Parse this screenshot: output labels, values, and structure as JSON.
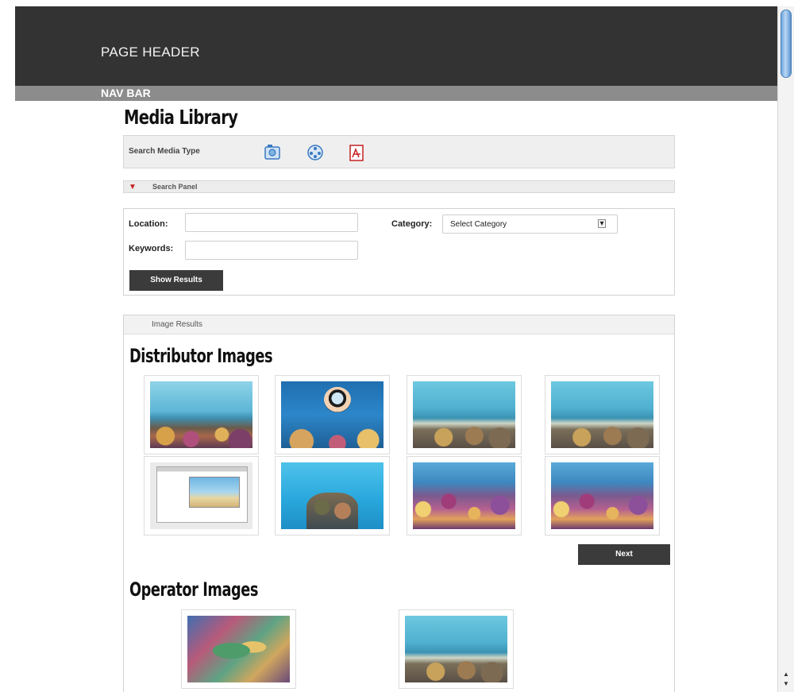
{
  "header": {
    "title": "PAGE HEADER"
  },
  "nav": {
    "label": "NAV BAR"
  },
  "page": {
    "title": "Media Library"
  },
  "media_type": {
    "label": "Search Media Type",
    "icons": [
      {
        "name": "image-type-icon",
        "glyph": "▣",
        "color": "#3a78c0"
      },
      {
        "name": "video-type-icon",
        "glyph": "◎",
        "color": "#3a78c0"
      },
      {
        "name": "pdf-type-icon",
        "glyph": "✎",
        "color": "#c62020"
      }
    ]
  },
  "search_panel": {
    "label": "Search Panel",
    "arrow": "▼",
    "location_label": "Location:",
    "location_value": "",
    "keywords_label": "Keywords:",
    "keywords_value": "",
    "category_label": "Category:",
    "category_selected": "Select Category",
    "show_results_label": "Show Results"
  },
  "results": {
    "header": "Image Results",
    "distributor_title": "Distributor Images",
    "operator_title": "Operator Images",
    "next_label": "Next",
    "distributor_images": [
      {
        "scene": "reef-a"
      },
      {
        "scene": "diver"
      },
      {
        "scene": "reef-b"
      },
      {
        "scene": "reef-b"
      },
      {
        "scene": "screenshot"
      },
      {
        "scene": "reef-c"
      },
      {
        "scene": "reef-d"
      },
      {
        "scene": "reef-d"
      }
    ],
    "operator_images": [
      {
        "scene": "painting"
      },
      {
        "scene": "reef-b"
      }
    ]
  }
}
